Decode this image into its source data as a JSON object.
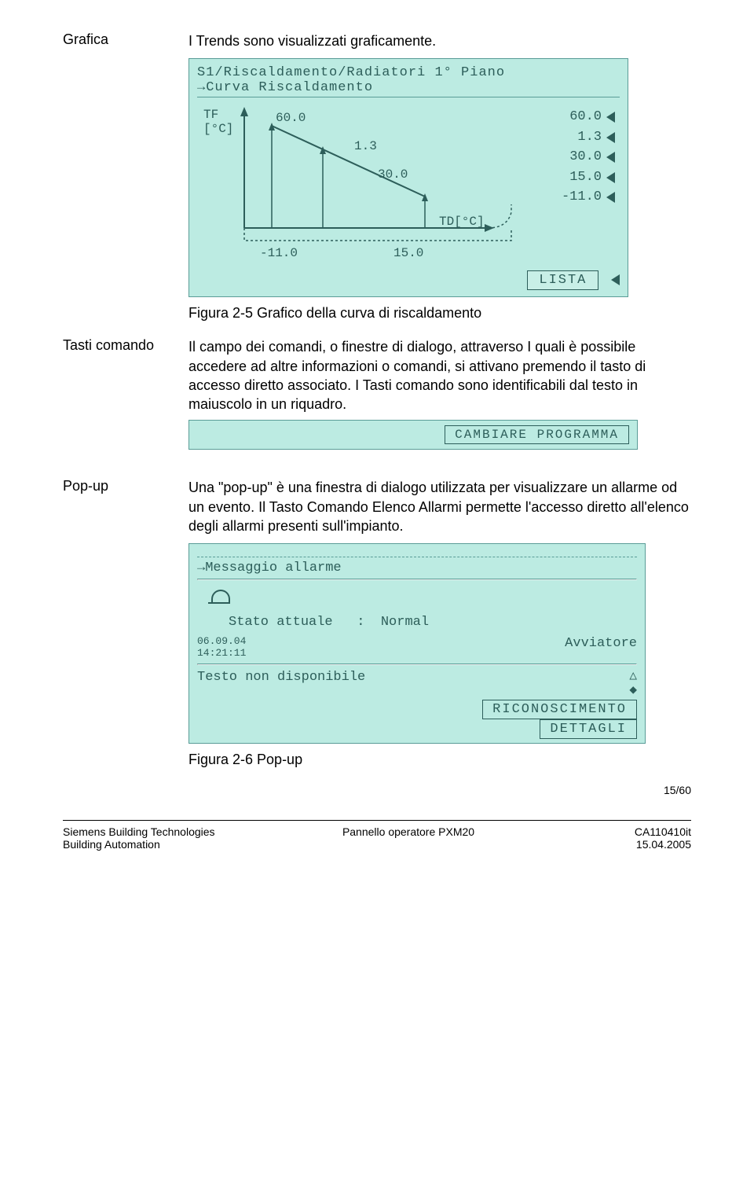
{
  "section1": {
    "label": "Grafica",
    "body": "I Trends sono visualizzati graficamente."
  },
  "chart_lcd": {
    "title_line1": "S1/Riscaldamento/Radiatori 1° Piano",
    "title_line2": "→Curva Riscaldamento",
    "y_label": "TF\n[°C]",
    "x_label": "TD[°C]",
    "left_top": "60.0",
    "mid_top": "1.3",
    "mid_low": "30.0",
    "x_min": "-11.0",
    "x_max": "15.0",
    "right_values": [
      "60.0",
      "1.3",
      "30.0",
      "15.0",
      "-11.0"
    ],
    "button": "LISTA"
  },
  "fig25_caption": "Figura  2-5 Grafico della curva di riscaldamento",
  "section2": {
    "label": "Tasti comando",
    "body": "Il campo dei comandi, o finestre di dialogo, attraverso I quali è possibile accedere ad altre informazioni o comandi, si attivano premendo il tasto di accesso diretto associato. I Tasti comando sono identificabili dal testo in maiuscolo in un riquadro."
  },
  "strip_button": "CAMBIARE PROGRAMMA",
  "section3": {
    "label": "Pop-up",
    "body": "Una \"pop-up\" è una finestra di dialogo utilizzata per visualizzare un allarme od un evento. Il Tasto Comando Elenco Allarmi permette l'accesso diretto all'elenco degli allarmi presenti sull'impianto."
  },
  "popup_lcd": {
    "line1": "→Messaggio allarme",
    "state_label": "Stato attuale",
    "state_value": "Normal",
    "date": "06.09.04",
    "time": "14:21:11",
    "avviatore": "Avviatore",
    "testo": "Testo non disponibile",
    "btn1": "RICONOSCIMENTO",
    "btn2": "DETTAGLI"
  },
  "fig26_caption": "Figura 2-6 Pop-up",
  "footer": {
    "page_num": "15/60",
    "left1": "Siemens Building Technologies",
    "left2": "Building Automation",
    "mid": "Pannello operatore PXM20",
    "right1": "CA110410it",
    "right2": "15.04.2005"
  },
  "chart_data": {
    "type": "line",
    "title": "Curva Riscaldamento",
    "xlabel": "TD [°C]",
    "ylabel": "TF [°C]",
    "x": [
      -11.0,
      15.0
    ],
    "y": [
      60.0,
      30.0
    ],
    "annotations": {
      "slope": 1.3
    },
    "xlim": [
      -11.0,
      15.0
    ],
    "ylim": [
      30.0,
      60.0
    ],
    "side_parameters": [
      60.0,
      1.3,
      30.0,
      15.0,
      -11.0
    ]
  }
}
